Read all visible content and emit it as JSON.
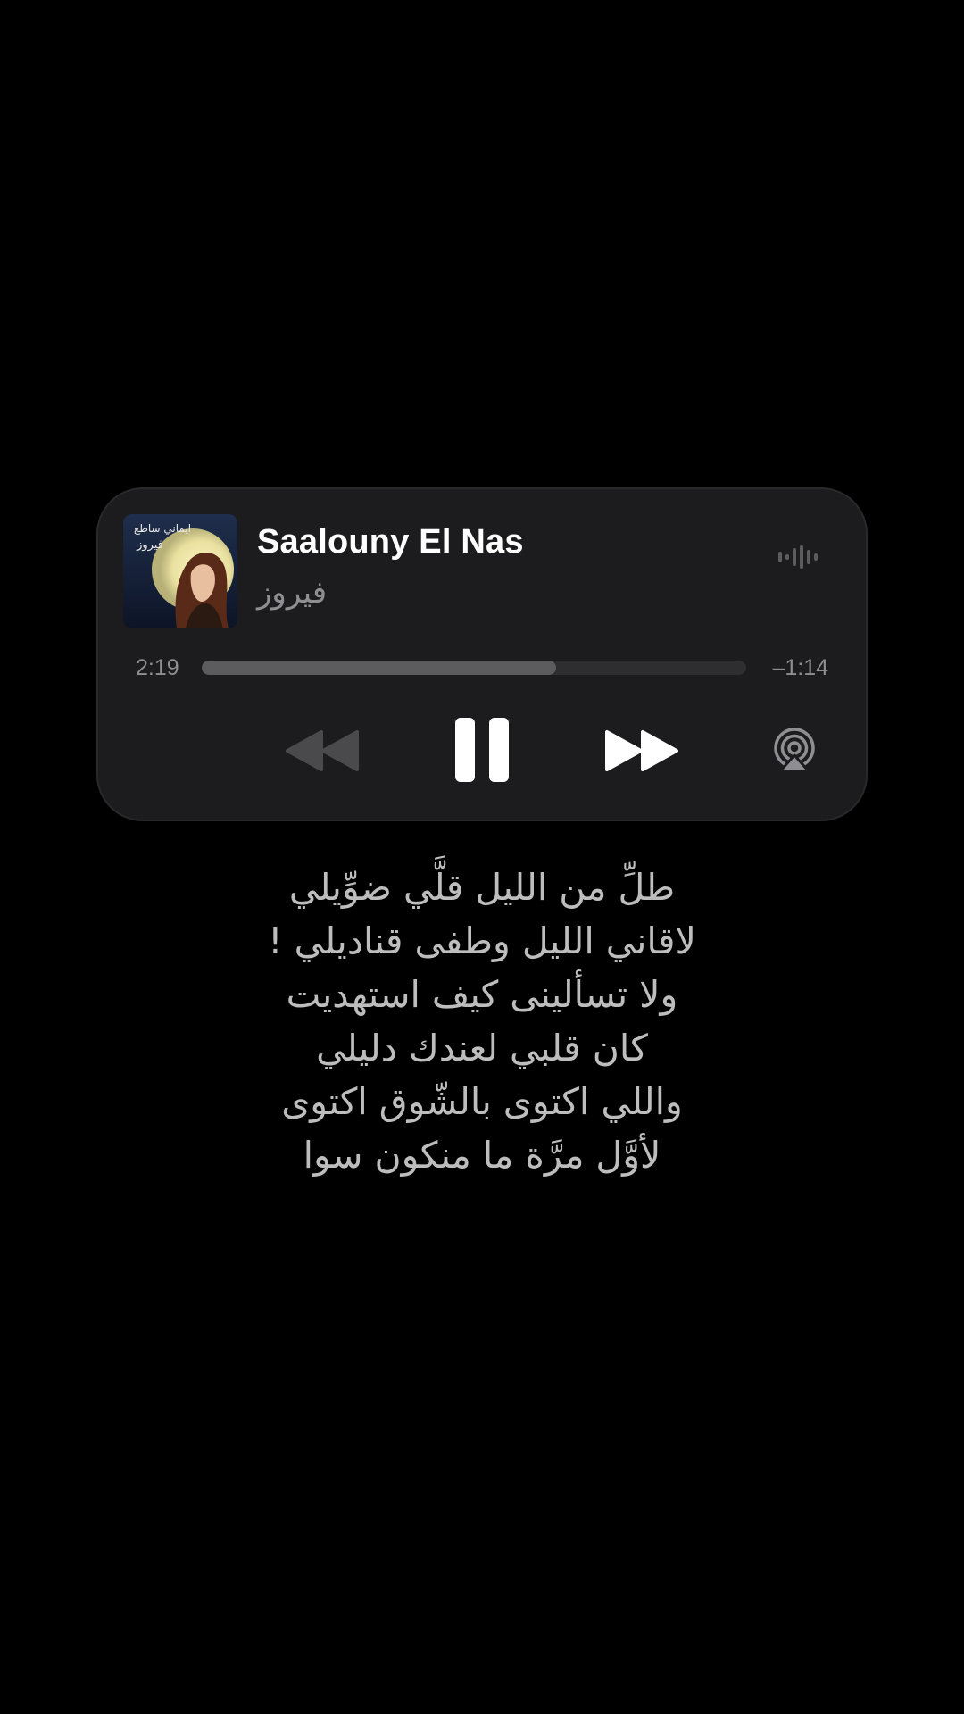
{
  "now_playing": {
    "title": "Saalouny El Nas",
    "artist": "فيروز",
    "album_art_text": [
      "ايماني ساطع",
      "فيروز"
    ],
    "elapsed": "2:19",
    "remaining": "–1:14",
    "progress": 0.65,
    "controls": {
      "rewind_icon": "rewind-icon",
      "pause_icon": "pause-icon",
      "forward_icon": "fast-forward-icon",
      "airplay_icon": "airplay-icon",
      "waveform_icon": "waveform-icon"
    },
    "colors": {
      "card_bg": "#1c1c1e",
      "progress_fill": "#5c5c5e",
      "progress_track": "#2e2e30",
      "secondary_text": "#8e8e93"
    }
  },
  "lyrics": [
    "طلِّ من الليل قلَّي ضوِّيلي",
    "لاقاني الليل وطفى قناديلي !",
    "ولا تسألينى كيف استهديت",
    "كان قلبي لعندك دليلي",
    "واللي اكتوى بالشّوق اكتوى",
    "لأوَّل مرَّة ما منكون سوا"
  ]
}
